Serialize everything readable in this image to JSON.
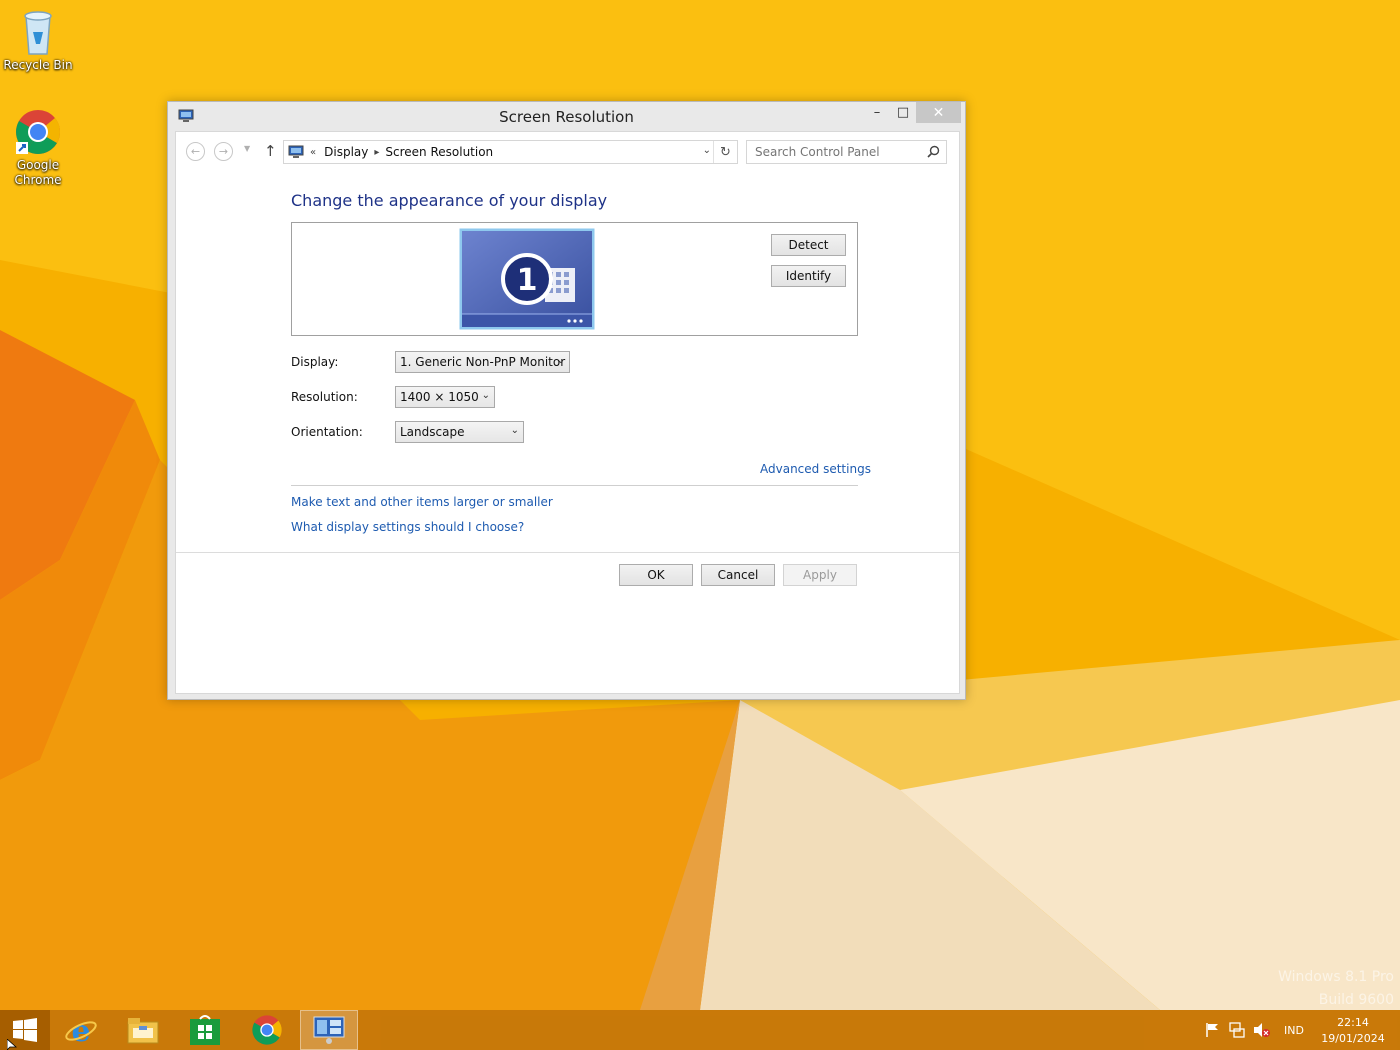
{
  "desktop": {
    "icons": [
      {
        "label": "Recycle Bin",
        "icon": "recycle-bin-icon"
      },
      {
        "label": "Google Chrome",
        "icon": "chrome-icon"
      }
    ],
    "watermark": {
      "line1": "Windows 8.1 Pro",
      "line2": "Build 9600"
    }
  },
  "window": {
    "title": "Screen Resolution",
    "controls": {
      "minimize": "–",
      "maximize": "□",
      "close": "✕"
    },
    "navigation": {
      "back": "←",
      "forward": "→",
      "up": "↑",
      "breadcrumb_prefix": "«",
      "breadcrumbs": [
        "Display",
        "Screen Resolution"
      ],
      "search_placeholder": "Search Control Panel"
    },
    "content": {
      "heading": "Change the appearance of your display",
      "monitor_number": "1",
      "detect_label": "Detect",
      "identify_label": "Identify",
      "display_label": "Display:",
      "display_value": "1. Generic Non-PnP Monitor",
      "resolution_label": "Resolution:",
      "resolution_value": "1400 × 1050",
      "orientation_label": "Orientation:",
      "orientation_value": "Landscape",
      "advanced_link": "Advanced settings",
      "text_size_link": "Make text and other items larger or smaller",
      "help_link": "What display settings should I choose?"
    },
    "buttons": {
      "ok": "OK",
      "cancel": "Cancel",
      "apply": "Apply"
    }
  },
  "taskbar": {
    "pinned": [
      "start-icon",
      "internet-explorer-icon",
      "file-explorer-icon",
      "store-icon",
      "chrome-icon",
      "display-settings-icon"
    ],
    "language": "IND",
    "time": "22:14",
    "date": "19/01/2024"
  },
  "colors": {
    "accent_link": "#1e5bb0",
    "heading": "#1e3287",
    "taskbar": "#c4740a"
  }
}
